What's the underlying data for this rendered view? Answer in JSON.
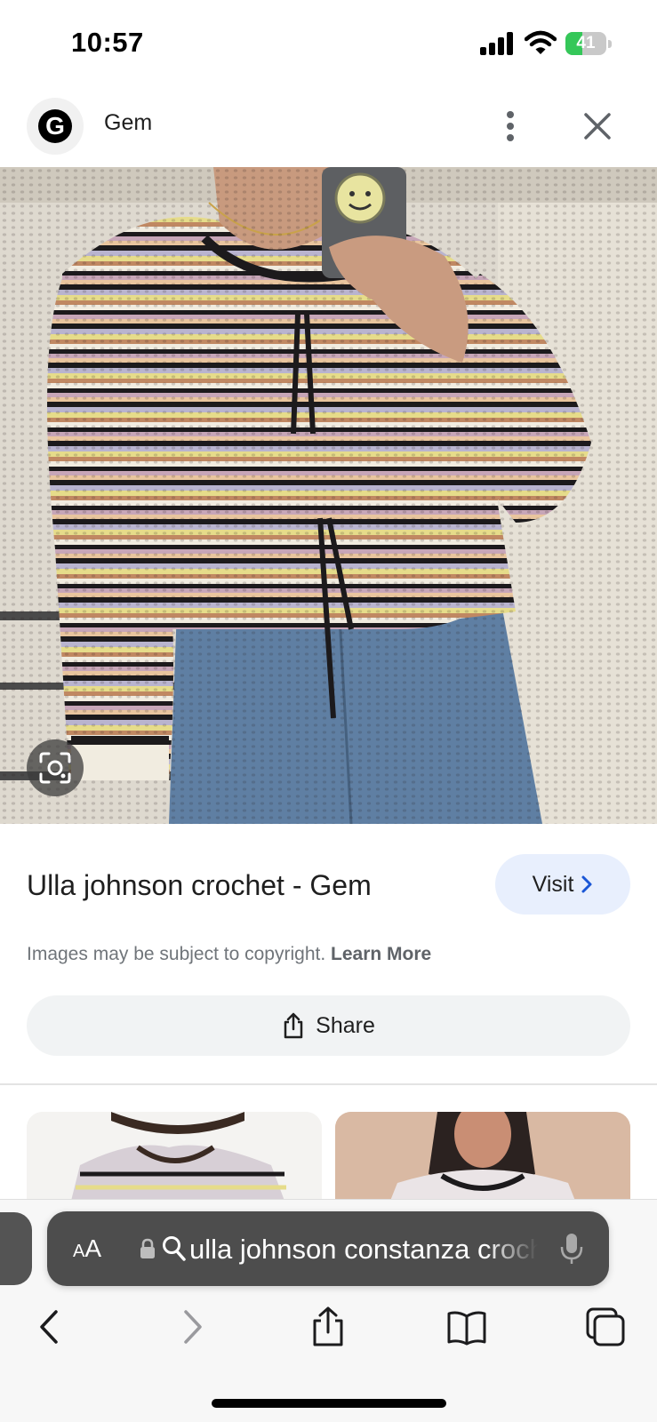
{
  "status_bar": {
    "time": "10:57",
    "battery_percent": "41",
    "battery_level": 0.41,
    "icons": [
      "cellular-signal-icon",
      "wifi-icon",
      "battery-charging-icon"
    ]
  },
  "header": {
    "site_logo_letter": "G",
    "site_name": "Gem",
    "more_icon": "vertical-ellipsis-icon",
    "close_icon": "close-icon"
  },
  "image": {
    "lens_icon": "image-search-icon"
  },
  "result": {
    "title": "Ulla johnson crochet - Gem",
    "visit_label": "Visit",
    "copyright_text": "Images may be subject to copyright.",
    "learn_more": "Learn More",
    "share_label": "Share"
  },
  "browser": {
    "text_size_label": "AA",
    "address_text": "ulla johnson constanza crochet",
    "icons": [
      "lock-icon",
      "search-icon",
      "microphone-icon",
      "back-icon",
      "forward-icon",
      "share-icon",
      "bookmarks-icon",
      "tabs-icon"
    ]
  },
  "colors": {
    "visit_bg": "#e8effd",
    "share_bg": "#f1f3f4",
    "battery_green": "#35c759",
    "address_bar_bg": "#4d4d4d"
  }
}
